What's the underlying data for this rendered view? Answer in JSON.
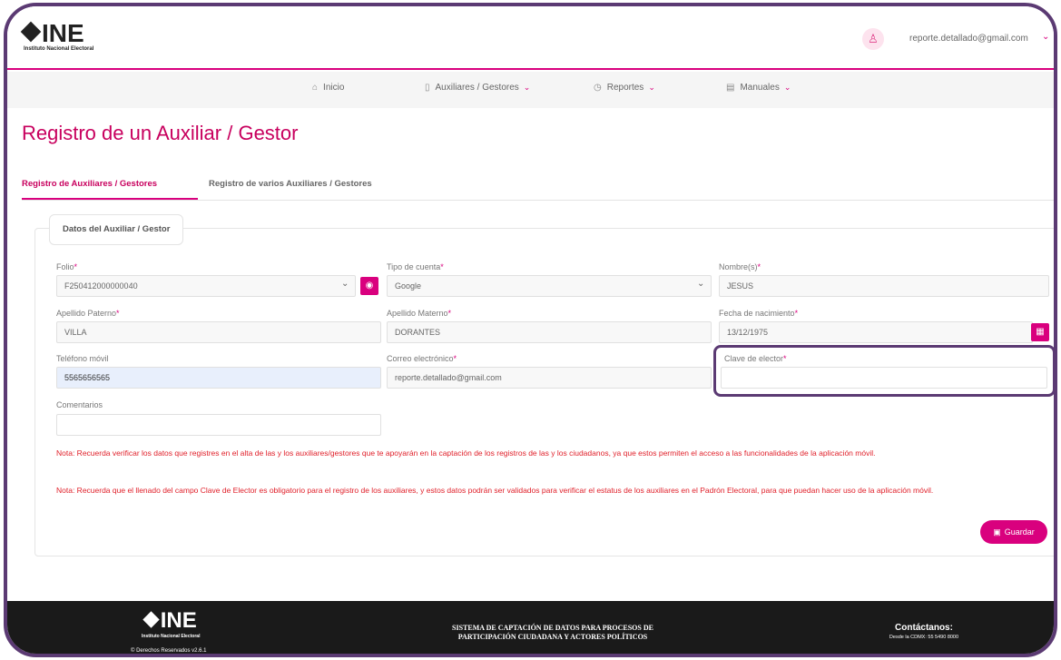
{
  "header": {
    "logo_text": "INE",
    "logo_subtitle": "Instituto Nacional Electoral",
    "user_email": "reporte.detallado@gmail.com"
  },
  "nav": {
    "items": [
      {
        "label": "Inicio",
        "icon": "home-icon"
      },
      {
        "label": "Auxiliares / Gestores",
        "icon": "document-icon"
      },
      {
        "label": "Reportes",
        "icon": "clock-icon"
      },
      {
        "label": "Manuales",
        "icon": "manual-icon"
      }
    ]
  },
  "page": {
    "title": "Registro de un Auxiliar / Gestor"
  },
  "tabs": [
    {
      "label": "Registro de Auxiliares / Gestores",
      "active": true
    },
    {
      "label": "Registro de varios Auxiliares / Gestores",
      "active": false
    }
  ],
  "form": {
    "legend": "Datos del Auxiliar / Gestor",
    "folio": {
      "label": "Folio",
      "value": "F250412000000040"
    },
    "tipo_cuenta": {
      "label": "Tipo de cuenta",
      "value": "Google"
    },
    "nombre": {
      "label": "Nombre(s)",
      "value": "JESUS"
    },
    "apellido_paterno": {
      "label": "Apellido Paterno",
      "value": "VILLA"
    },
    "apellido_materno": {
      "label": "Apellido Materno",
      "value": "DORANTES"
    },
    "fecha_nacimiento": {
      "label": "Fecha de nacimiento",
      "value": "13/12/1975"
    },
    "telefono": {
      "label": "Teléfono móvil",
      "value": "5565656565"
    },
    "correo": {
      "label": "Correo electrónico",
      "value": "reporte.detallado@gmail.com"
    },
    "clave_elector": {
      "label": "Clave de elector",
      "value": ""
    },
    "comentarios": {
      "label": "Comentarios",
      "value": ""
    },
    "required_mark": "*",
    "note1": "Nota: Recuerda verificar los datos que registres en el alta de las y los auxiliares/gestores que te apoyarán en la captación de los registros de las y los ciudadanos, ya que estos permiten el acceso a las funcionalidades de la aplicación móvil.",
    "note2": "Nota: Recuerda que el llenado del campo Clave de Elector es obligatorio para el registro de los auxiliares, y estos datos podrán ser validados para verificar el estatus de los auxiliares en el Padrón Electoral, para que puedan hacer uso de la aplicación móvil.",
    "save_label": "Guardar"
  },
  "footer": {
    "logo_text": "INE",
    "logo_subtitle": "Instituto Nacional Electoral",
    "rights": "© Derechos Reservados v2.6.1",
    "system_line1": "SISTEMA DE CAPTACIÓN DE DATOS PARA PROCESOS DE",
    "system_line2": "PARTICIPACIÓN CIUDADANA Y ACTORES POLÍTICOS",
    "contact_title": "Contáctanos:",
    "contact_sub": "Desde la CDMX: 55 5490 8000"
  },
  "colors": {
    "accent": "#d9007e",
    "title": "#c8005e",
    "note": "#e0202a",
    "frame": "#5b3a73"
  }
}
